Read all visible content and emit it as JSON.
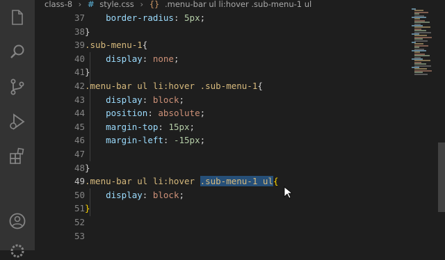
{
  "breadcrumb": {
    "folder": "class-8",
    "file": "style.css",
    "symbol": ".menu-bar ul li:hover .sub-menu-1 ul"
  },
  "activity_bar": {
    "items": [
      "explorer-icon",
      "search-icon",
      "source-control-icon",
      "run-debug-icon",
      "extensions-icon"
    ],
    "bottom": [
      "account-icon",
      "settings-icon"
    ]
  },
  "editor": {
    "line_numbers": [
      "37",
      "38",
      "39",
      "40",
      "41",
      "42",
      "43",
      "44",
      "45",
      "46",
      "47",
      "48",
      "49",
      "50",
      "51",
      "52",
      "53"
    ],
    "active_line": "49",
    "lines": [
      {
        "indent": "    ",
        "tokens": [
          [
            "prop",
            "border-radius"
          ],
          [
            "punc",
            ": "
          ],
          [
            "num",
            "5px"
          ],
          [
            "punc",
            ";"
          ]
        ]
      },
      {
        "indent": "",
        "tokens": [
          [
            "punc",
            "}"
          ]
        ]
      },
      {
        "indent": "",
        "tokens": [
          [
            "sel",
            ".sub-menu-1"
          ],
          [
            "punc",
            "{"
          ]
        ]
      },
      {
        "indent": "    ",
        "tokens": [
          [
            "prop",
            "display"
          ],
          [
            "punc",
            ": "
          ],
          [
            "val",
            "none"
          ],
          [
            "punc",
            ";"
          ]
        ]
      },
      {
        "indent": "",
        "tokens": [
          [
            "punc",
            "}"
          ]
        ]
      },
      {
        "indent": "",
        "tokens": [
          [
            "sel",
            ".menu-bar ul li:hover .sub-menu-1"
          ],
          [
            "punc",
            "{"
          ]
        ]
      },
      {
        "indent": "    ",
        "tokens": [
          [
            "prop",
            "display"
          ],
          [
            "punc",
            ": "
          ],
          [
            "val",
            "block"
          ],
          [
            "punc",
            ";"
          ]
        ]
      },
      {
        "indent": "    ",
        "tokens": [
          [
            "prop",
            "position"
          ],
          [
            "punc",
            ": "
          ],
          [
            "val",
            "absolute"
          ],
          [
            "punc",
            ";"
          ]
        ]
      },
      {
        "indent": "    ",
        "tokens": [
          [
            "prop",
            "margin-top"
          ],
          [
            "punc",
            ": "
          ],
          [
            "num",
            "15px"
          ],
          [
            "punc",
            ";"
          ]
        ]
      },
      {
        "indent": "    ",
        "tokens": [
          [
            "prop",
            "margin-left"
          ],
          [
            "punc",
            ": "
          ],
          [
            "num",
            "-15px"
          ],
          [
            "punc",
            ";"
          ]
        ]
      },
      {
        "indent": "",
        "tokens": []
      },
      {
        "indent": "",
        "tokens": [
          [
            "punc",
            "}"
          ]
        ]
      },
      {
        "indent": "",
        "tokens": [
          [
            "sel",
            ".menu-bar ul li:hover "
          ],
          [
            "selhl",
            ".sub-menu-1 ul"
          ],
          [
            "brace",
            "{"
          ]
        ]
      },
      {
        "indent": "    ",
        "tokens": [
          [
            "prop",
            "display"
          ],
          [
            "punc",
            ": "
          ],
          [
            "val",
            "block"
          ],
          [
            "punc",
            ";"
          ]
        ]
      },
      {
        "indent": "",
        "tokens": [
          [
            "brace",
            "}"
          ]
        ]
      },
      {
        "indent": "",
        "tokens": []
      },
      {
        "indent": "",
        "tokens": []
      }
    ]
  },
  "colors": {
    "activity_bar": "#333333",
    "editor_bg": "#1e1e1e",
    "selection": "#264f78"
  }
}
